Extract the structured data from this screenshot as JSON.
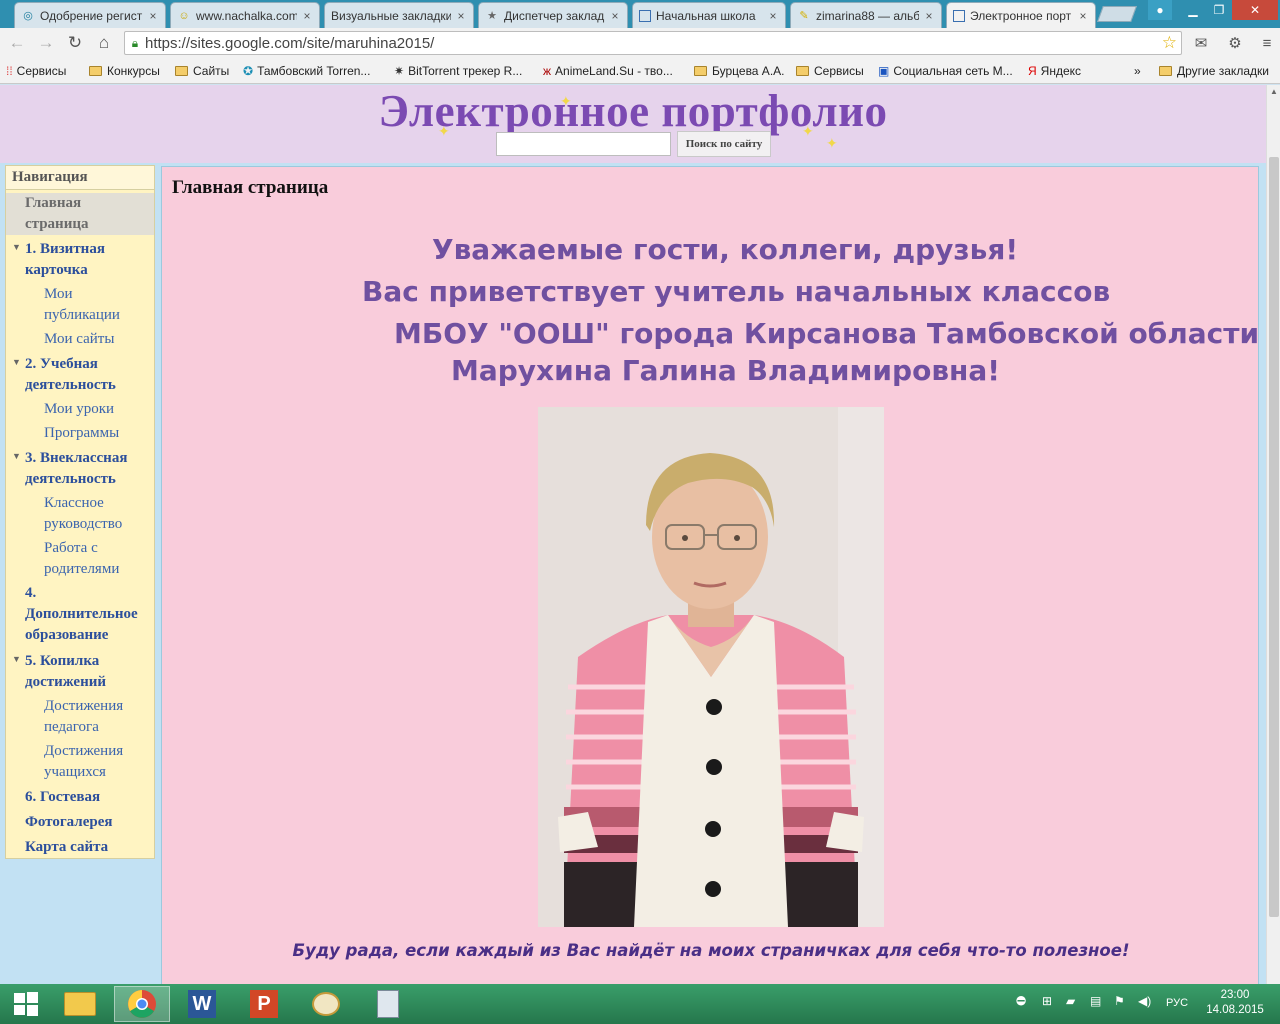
{
  "tabs": [
    {
      "title": "Одобрение регист",
      "icon": "registration-icon",
      "active": false
    },
    {
      "title": "www.nachalka.com",
      "icon": "nachalka-icon",
      "active": false
    },
    {
      "title": "Визуальные закладки",
      "icon": "",
      "active": false
    },
    {
      "title": "Диспетчер заклад",
      "icon": "star-icon",
      "active": false
    },
    {
      "title": "Начальная школа",
      "icon": "page-icon",
      "active": false
    },
    {
      "title": "zimarina88 — альб",
      "icon": "album-icon",
      "active": false
    },
    {
      "title": "Электронное порт",
      "icon": "page-icon",
      "active": true
    }
  ],
  "tab_close": "×",
  "address_bar": {
    "url": "https://sites.google.com/site/maruhina2015/"
  },
  "bookmarks": [
    {
      "label": "Сервисы",
      "icon": "apps-icon"
    },
    {
      "label": "Конкурсы",
      "icon": "folder-icon"
    },
    {
      "label": "Сайты",
      "icon": "folder-icon"
    },
    {
      "label": "Тамбовский Torren...",
      "icon": "tambov-icon"
    },
    {
      "label": "BitTorrent трекер R...",
      "icon": "bittorrent-icon"
    },
    {
      "label": "AnimeLand.Su - тво...",
      "icon": "animeland-icon"
    },
    {
      "label": "Бурцева А.А.",
      "icon": "folder-icon"
    },
    {
      "label": "Сервисы",
      "icon": "folder-icon"
    },
    {
      "label": "Социальная сеть М...",
      "icon": "social-icon"
    },
    {
      "label": "Яндекс",
      "icon": "yandex-icon"
    }
  ],
  "bookmarks_more": "»",
  "other_bookmarks": "Другие закладки",
  "site": {
    "title": "Электронное портфолио",
    "search_button": "Поиск по сайту"
  },
  "nav": {
    "title": "Навигация",
    "items": [
      {
        "lines": [
          "Главная",
          "страница"
        ],
        "level": "current"
      },
      {
        "lines": [
          "1. Визитная",
          "карточка"
        ],
        "level": "top",
        "expanded": true
      },
      {
        "lines": [
          "Мои",
          "публикации"
        ],
        "level": "sub"
      },
      {
        "lines": [
          "Мои сайты"
        ],
        "level": "sub"
      },
      {
        "lines": [
          "2. Учебная",
          "деятельность"
        ],
        "level": "top",
        "expanded": true
      },
      {
        "lines": [
          "Мои уроки"
        ],
        "level": "sub"
      },
      {
        "lines": [
          "Программы"
        ],
        "level": "sub"
      },
      {
        "lines": [
          "3. Внеклассная",
          "деятельность"
        ],
        "level": "top",
        "expanded": true
      },
      {
        "lines": [
          "Классное",
          "руководство"
        ],
        "level": "sub"
      },
      {
        "lines": [
          "Работа с",
          "родителями"
        ],
        "level": "sub"
      },
      {
        "lines": [
          "4.",
          "Дополнительное",
          "образование"
        ],
        "level": "top"
      },
      {
        "lines": [
          "5. Копилка",
          "достижений"
        ],
        "level": "top",
        "expanded": true
      },
      {
        "lines": [
          "Достижения",
          "педагога"
        ],
        "level": "sub"
      },
      {
        "lines": [
          "Достижения",
          "учащихся"
        ],
        "level": "sub"
      },
      {
        "lines": [
          "6. Гостевая"
        ],
        "level": "top"
      },
      {
        "lines": [
          "Фотогалерея"
        ],
        "level": "top"
      },
      {
        "lines": [
          "Карта сайта"
        ],
        "level": "top"
      }
    ]
  },
  "content": {
    "heading": "Главная страница",
    "greeting": [
      "Уважаемые гости, коллеги, друзья!",
      "Вас приветствует учитель начальных классов",
      "МБОУ \"ООШ\" города Кирсанова Тамбовской области",
      "Марухина Галина Владимировна!"
    ],
    "closing": "Буду рада, если каждый из Вас найдёт на моих страничках для себя что-то полезное!"
  },
  "taskbar": {
    "apps": [
      "explorer-icon",
      "chrome-icon",
      "word-icon",
      "powerpoint-icon",
      "paint-icon",
      "calculator-icon"
    ],
    "language": "РУС",
    "time": "23:00",
    "date": "14.08.2015"
  },
  "colors": {
    "title": "#7b4ab2",
    "greeting": "#7050a0",
    "nav_link": "#2c4f9c",
    "content_bg": "#f9ccdb",
    "nav_bg": "#fff4c2"
  }
}
